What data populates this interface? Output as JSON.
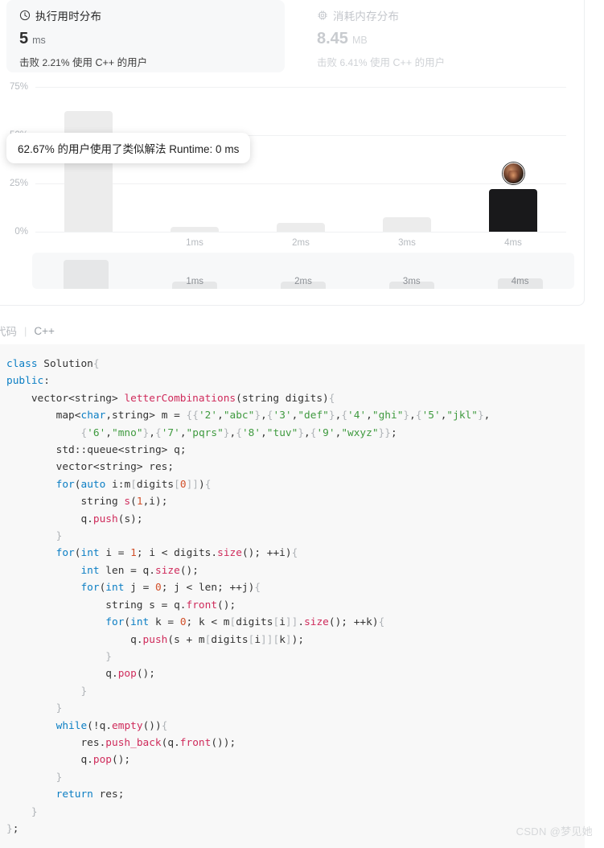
{
  "runtime_card": {
    "icon": "clock-icon",
    "title": "执行用时分布",
    "value": "5",
    "unit": "ms",
    "beat_prefix": "击败",
    "beat_pct": "2.21%",
    "beat_suffix": "使用 C++ 的用户"
  },
  "memory_card": {
    "icon": "memory-chip-icon",
    "title": "消耗内存分布",
    "value": "8.45",
    "unit": "MB",
    "beat_prefix": "击败",
    "beat_pct": "6.41%",
    "beat_suffix": "使用 C++ 的用户"
  },
  "tooltip": {
    "text": "62.67% 的用户使用了类似解法 Runtime: 0 ms"
  },
  "chart_data": {
    "type": "bar",
    "title": "执行用时分布",
    "xlabel": "",
    "ylabel": "",
    "categories": [
      "0ms",
      "1ms",
      "2ms",
      "3ms",
      "4ms"
    ],
    "values": [
      62.67,
      2.5,
      4.5,
      7.5,
      22.0
    ],
    "tick_labels": [
      "",
      "1ms",
      "2ms",
      "3ms",
      "4ms"
    ],
    "ylim": [
      0,
      75
    ],
    "yticks": [
      "0%",
      "25%",
      "50%",
      "75%"
    ],
    "ytick_values": [
      0,
      25,
      50,
      75
    ],
    "grid": true,
    "legend": "none",
    "highlight_index": 4,
    "highlight_color": "#19191b",
    "bar_color": "#ececec",
    "annotation": "62.67% 的用户使用了类似解法 Runtime: 0 ms",
    "marker": {
      "type": "avatar",
      "category": "4ms"
    }
  },
  "minimap": {
    "categories": [
      "0ms",
      "1ms",
      "2ms",
      "3ms",
      "4ms"
    ],
    "values": [
      62.67,
      2.5,
      4.5,
      7.5,
      22.0
    ],
    "tick_labels": [
      "1ms",
      "2ms",
      "3ms",
      "4ms"
    ]
  },
  "code_header": {
    "label": "代码",
    "separator": "|",
    "language": "C++"
  },
  "code": {
    "lines": [
      "class Solution{",
      "public:",
      "    vector<string> letterCombinations(string digits){",
      "        map<char,string> m = {{'2',\"abc\"},{'3',\"def\"},{'4',\"ghi\"},{'5',\"jkl\"},",
      "            {'6',\"mno\"},{'7',\"pqrs\"},{'8',\"tuv\"},{'9',\"wxyz\"}};",
      "        std::queue<string> q;",
      "        vector<string> res;",
      "        for(auto i:m[digits[0]]){",
      "            string s(1,i);",
      "            q.push(s);",
      "        }",
      "        for(int i = 1; i < digits.size(); ++i){",
      "            int len = q.size();",
      "            for(int j = 0; j < len; ++j){",
      "                string s = q.front();",
      "                for(int k = 0; k < m[digits[i]].size(); ++k){",
      "                    q.push(s + m[digits[i]][k]);",
      "                }",
      "                q.pop();",
      "            }",
      "        }",
      "        while(!q.empty()){",
      "            res.push_back(q.front());",
      "            q.pop();",
      "        }",
      "        return res;",
      "    }",
      "};"
    ]
  },
  "watermark": {
    "text": "CSDN @梦见她"
  }
}
